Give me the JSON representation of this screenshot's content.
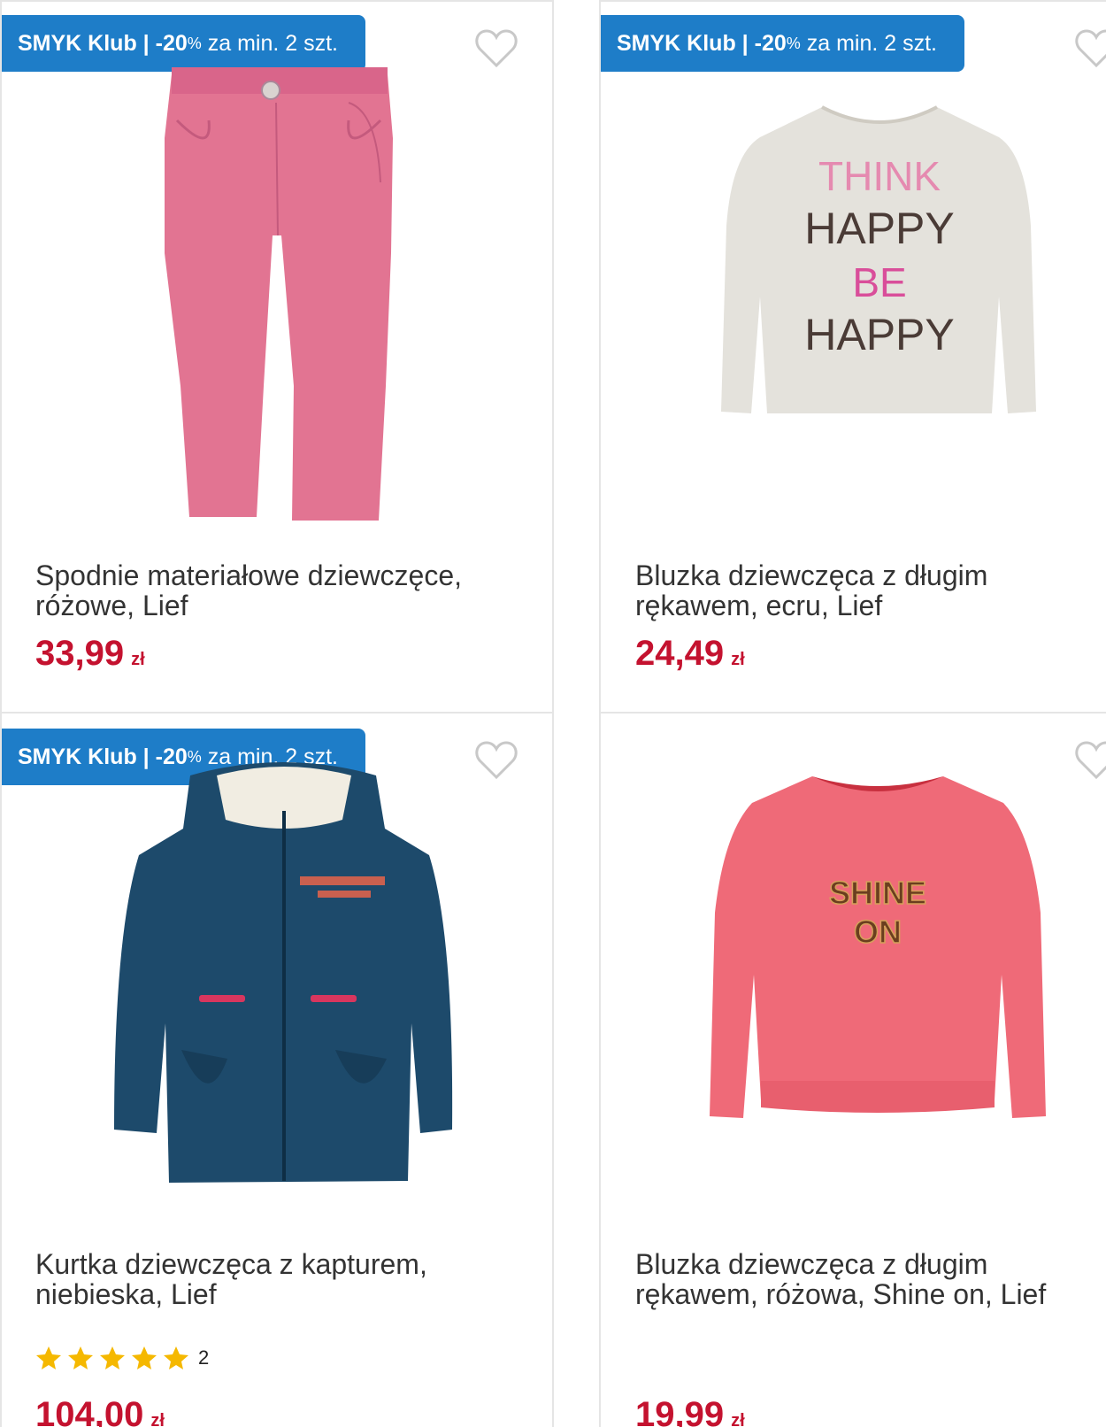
{
  "products": [
    {
      "badge": {
        "brand": "SMYK Klub",
        "separator": "|",
        "discount": "-20",
        "percent": "%",
        "condition": "za min. 2 szt."
      },
      "title_line1": "Spodnie materiałowe dziewczęce,",
      "title_line2": "różowe, Lief",
      "price": "33,99",
      "currency": "zł",
      "image": "pink-trousers",
      "favorite_icon": "heart-outline-icon"
    },
    {
      "badge": {
        "brand": "SMYK Klub",
        "separator": "|",
        "discount": "-20",
        "percent": "%",
        "condition": "za min. 2 szt."
      },
      "title_line1": "Bluzka dziewczęca z długim",
      "title_line2": "rękawem, ecru, Lief",
      "price": "24,49",
      "currency": "zł",
      "image": "ecru-long-sleeve-top",
      "print_text": [
        "THINK",
        "HAPPY",
        "BE",
        "HAPPY"
      ],
      "favorite_icon": "heart-outline-icon"
    },
    {
      "badge": {
        "brand": "SMYK Klub",
        "separator": "|",
        "discount": "-20",
        "percent": "%",
        "condition": "za min. 2 szt."
      },
      "title_line1": "Kurtka dziewczęca z kapturem,",
      "title_line2": "niebieska, Lief",
      "rating": {
        "stars": 5,
        "count": "2"
      },
      "price": "104,00",
      "currency": "zł",
      "image": "navy-hooded-jacket",
      "favorite_icon": "heart-outline-icon"
    },
    {
      "title_line1": "Bluzka dziewczęca z długim",
      "title_line2": "rękawem, różowa, Shine on, Lief",
      "price": "19,99",
      "currency": "zł",
      "image": "pink-long-sleeve-top",
      "print_text": [
        "SHINE",
        "ON"
      ],
      "favorite_icon": "heart-outline-icon"
    }
  ],
  "colors": {
    "badge_bg": "#1e7dc8",
    "price": "#c4122f",
    "star": "#f5b800",
    "divider": "#e5e5e5"
  }
}
